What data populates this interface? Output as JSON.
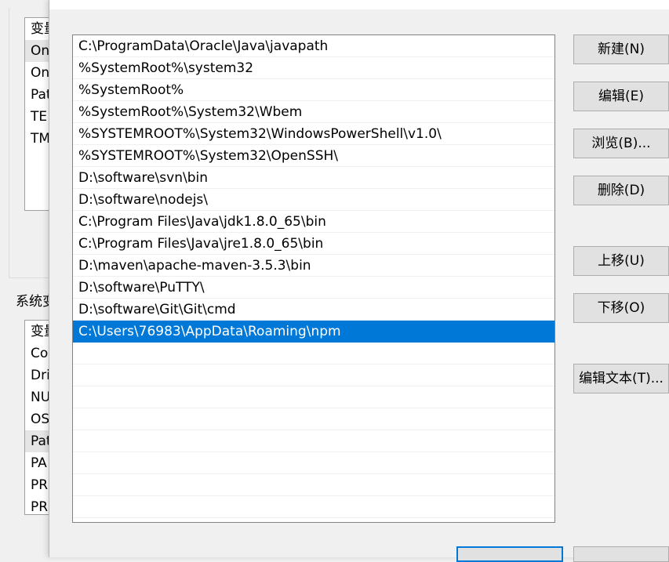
{
  "background": {
    "user_vars_list": {
      "header": "变量",
      "items": [
        "On",
        "On",
        "Pat",
        "TE",
        "TM"
      ]
    },
    "system_caption": "系统变",
    "system_vars_list": {
      "header": "变量",
      "items": [
        "Co",
        "Dri",
        "NU",
        "OS",
        "Pat",
        "PA",
        "PR",
        "PR"
      ]
    }
  },
  "dialog": {
    "paths": [
      "C:\\ProgramData\\Oracle\\Java\\javapath",
      "%SystemRoot%\\system32",
      "%SystemRoot%",
      "%SystemRoot%\\System32\\Wbem",
      "%SYSTEMROOT%\\System32\\WindowsPowerShell\\v1.0\\",
      "%SYSTEMROOT%\\System32\\OpenSSH\\",
      "D:\\software\\svn\\bin",
      "D:\\software\\nodejs\\",
      "C:\\Program Files\\Java\\jdk1.8.0_65\\bin",
      "C:\\Program Files\\Java\\jre1.8.0_65\\bin",
      "D:\\maven\\apache-maven-3.5.3\\bin",
      "D:\\software\\PuTTY\\",
      "D:\\software\\Git\\Git\\cmd",
      "C:\\Users\\76983\\AppData\\Roaming\\npm"
    ],
    "buttons": {
      "new": "新建(N)",
      "edit": "编辑(E)",
      "browse": "浏览(B)...",
      "delete": "删除(D)",
      "move_up": "上移(U)",
      "move_down": "下移(O)",
      "edit_text": "编辑文本(T)..."
    }
  }
}
